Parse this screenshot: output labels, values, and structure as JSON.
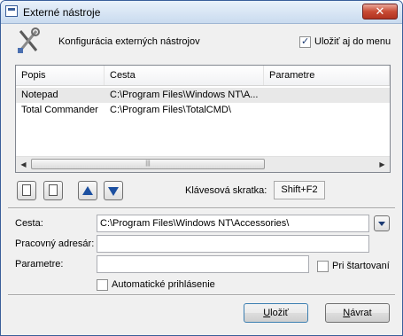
{
  "window": {
    "title": "Externé nástroje",
    "close_label": "✕"
  },
  "header": {
    "label": "Konfigurácia externých nástrojov",
    "icon": "tools-icon",
    "save_to_menu_label": "Uložiť aj do menu",
    "save_to_menu_checked": true
  },
  "list": {
    "columns": [
      "Popis",
      "Cesta",
      "Parametre"
    ],
    "rows": [
      {
        "popis": "Notepad",
        "cesta": "C:\\Program Files\\Windows NT\\A...",
        "parametre": "",
        "selected": true
      },
      {
        "popis": "Total Commander",
        "cesta": "C:\\Program Files\\TotalCMD\\",
        "parametre": "",
        "selected": false
      }
    ]
  },
  "toolbar": {
    "new_icon": "new-item-icon",
    "delete_icon": "delete-item-icon",
    "up_icon": "arrow-up-icon",
    "down_icon": "arrow-down-icon",
    "shortcut_label": "Klávesová skratka:",
    "shortcut_value": "Shift+F2"
  },
  "form": {
    "path_label": "Cesta:",
    "path_value": "C:\\Program Files\\Windows NT\\Accessories\\",
    "workdir_label": "Pracovný adresár:",
    "workdir_value": "",
    "params_label": "Parametre:",
    "params_value": "",
    "on_start_label": "Pri štartovaní",
    "on_start_checked": false,
    "auto_login_label": "Automatické prihlásenie",
    "auto_login_checked": false
  },
  "buttons": {
    "save_label": "Uložiť",
    "save_key": "U",
    "save_rest": "ložiť",
    "back_label": "Návrat",
    "back_key": "N",
    "back_rest": "ávrat"
  }
}
